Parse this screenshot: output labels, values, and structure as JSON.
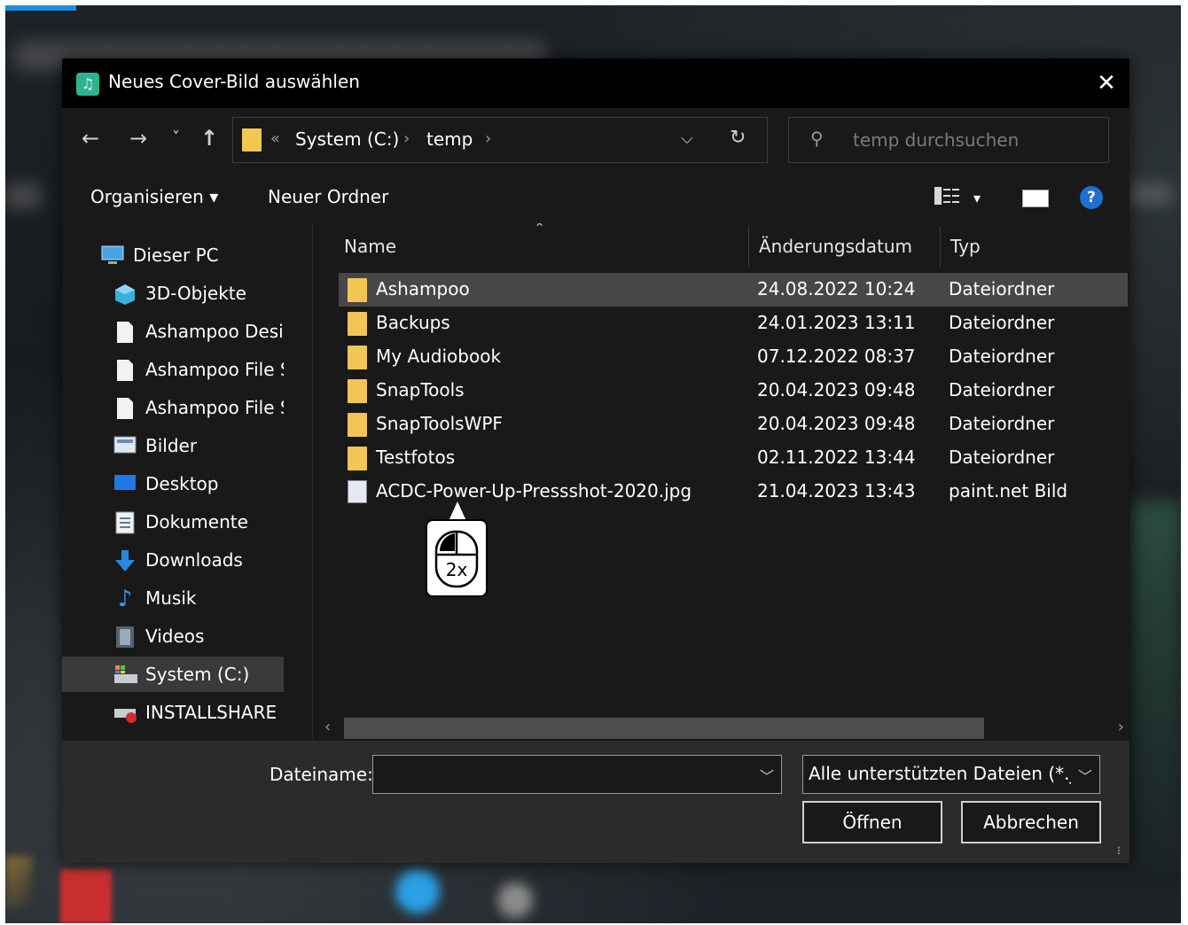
{
  "dialog": {
    "title": "Neues Cover-Bild auswählen",
    "close_symbol": "✕"
  },
  "nav": {
    "back": "←",
    "forward": "→",
    "recent": "˅",
    "up": "↑"
  },
  "address": {
    "overflow": "«",
    "segments": [
      "System (C:)",
      "temp"
    ],
    "separator": "›",
    "dropdown": "⌵",
    "refresh": "↻"
  },
  "search": {
    "placeholder": "temp durchsuchen"
  },
  "toolbar": {
    "organize": "Organisieren ▾",
    "new_folder": "Neuer Ordner",
    "view_dropdown": "▾",
    "help": "?"
  },
  "navpane": {
    "items": [
      {
        "label": "Dieser PC",
        "icon": "computer-icon",
        "selected": false
      },
      {
        "label": "3D-Objekte",
        "icon": "3d-objects-icon",
        "selected": false
      },
      {
        "label": "Ashampoo Desig",
        "icon": "document-icon",
        "selected": false
      },
      {
        "label": "Ashampoo File S",
        "icon": "document-icon",
        "selected": false
      },
      {
        "label": "Ashampoo File S",
        "icon": "document-icon",
        "selected": false
      },
      {
        "label": "Bilder",
        "icon": "pictures-icon",
        "selected": false
      },
      {
        "label": "Desktop",
        "icon": "desktop-icon",
        "selected": false
      },
      {
        "label": "Dokumente",
        "icon": "documents-icon",
        "selected": false
      },
      {
        "label": "Downloads",
        "icon": "download-icon",
        "selected": false
      },
      {
        "label": "Musik",
        "icon": "music-icon",
        "selected": false
      },
      {
        "label": "Videos",
        "icon": "videos-icon",
        "selected": false
      },
      {
        "label": "System (C:)",
        "icon": "drive-icon",
        "selected": true
      },
      {
        "label": "INSTALLSHARE (",
        "icon": "drive-error-icon",
        "selected": false
      }
    ]
  },
  "filelist": {
    "columns": [
      "Name",
      "Änderungsdatum",
      "Typ"
    ],
    "rows": [
      {
        "name": "Ashampoo",
        "date": "24.08.2022 10:24",
        "type": "Dateiordner",
        "icon": "folder-icon",
        "selected": true
      },
      {
        "name": "Backups",
        "date": "24.01.2023 13:11",
        "type": "Dateiordner",
        "icon": "folder-icon",
        "selected": false
      },
      {
        "name": "My Audiobook",
        "date": "07.12.2022 08:37",
        "type": "Dateiordner",
        "icon": "folder-icon",
        "selected": false
      },
      {
        "name": "SnapTools",
        "date": "20.04.2023 09:48",
        "type": "Dateiordner",
        "icon": "folder-icon",
        "selected": false
      },
      {
        "name": "SnapToolsWPF",
        "date": "20.04.2023 09:48",
        "type": "Dateiordner",
        "icon": "folder-icon",
        "selected": false
      },
      {
        "name": "Testfotos",
        "date": "02.11.2022 13:44",
        "type": "Dateiordner",
        "icon": "folder-icon",
        "selected": false
      },
      {
        "name": "ACDC-Power-Up-Pressshot-2020.jpg",
        "date": "21.04.2023 13:43",
        "type": "paint.net Bild",
        "icon": "image-file-icon",
        "selected": false
      }
    ]
  },
  "bottom": {
    "filename_label": "Dateiname:",
    "filename_value": "",
    "filetype_value": "Alle unterstützten Dateien (*.jpg",
    "open_button": "Öffnen",
    "cancel_button": "Abbrechen"
  },
  "callout": {
    "text": "2x",
    "icon": "mouse-double-click-icon"
  },
  "colors": {
    "dialog_bg": "#191919",
    "titlebar_bg": "#000000",
    "bottom_bg": "#2b2b2b",
    "folder": "#f3c553",
    "selection": "#474747",
    "help_blue": "#1f6fd1",
    "app_icon": "#2fb38e"
  }
}
